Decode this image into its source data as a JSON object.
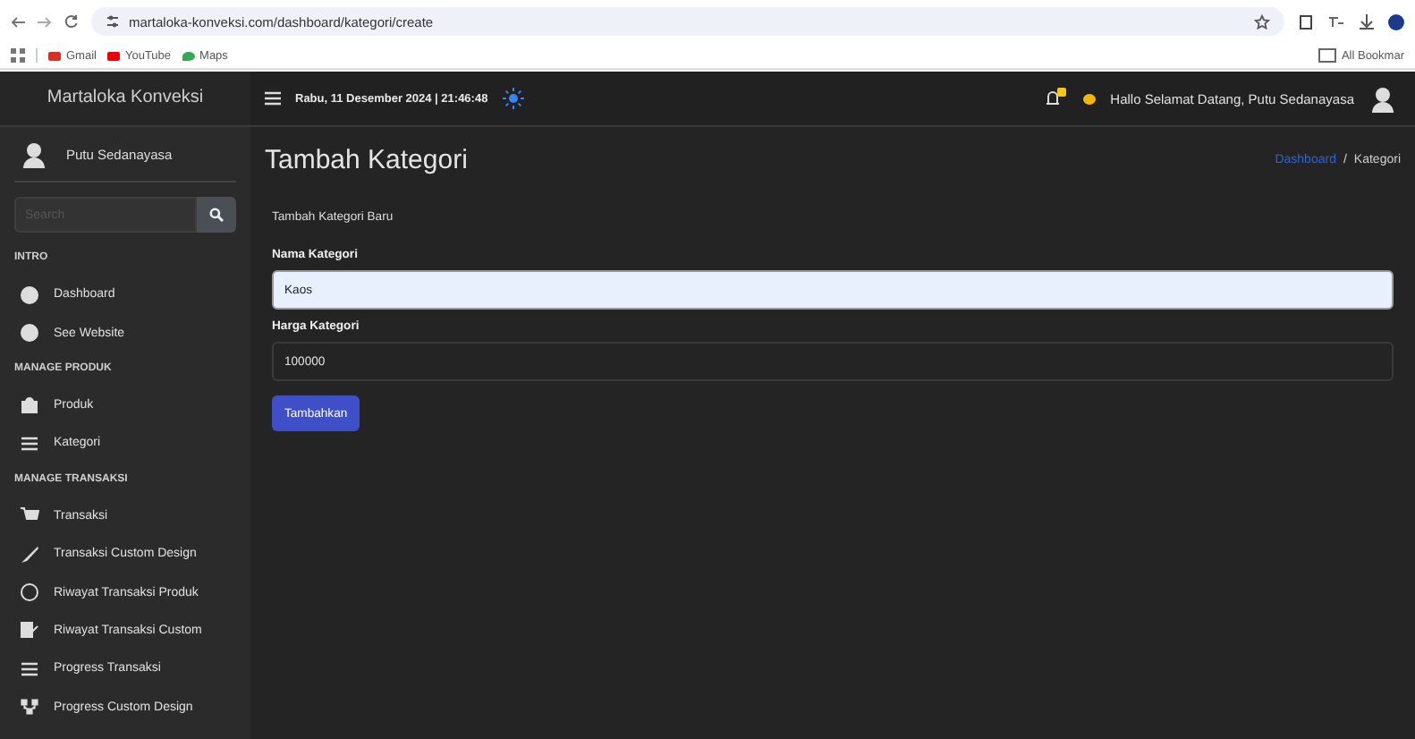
{
  "browser": {
    "url": "martaloka-konveksi.com/dashboard/kategori/create",
    "bookmarks": [
      {
        "label": "Gmail"
      },
      {
        "label": "YouTube"
      },
      {
        "label": "Maps"
      }
    ],
    "all_bookmarks": "All Bookmar"
  },
  "header": {
    "brand": "Martaloka Konveksi",
    "date_time": "Rabu, 11 Desember 2024 | 21:46:48",
    "greeting": "Hallo Selamat Datang, Putu Sedanayasa"
  },
  "sidebar": {
    "user_name": "Putu Sedanayasa",
    "search": {
      "placeholder": "Search"
    },
    "sections": [
      {
        "heading": "INTRO",
        "items": [
          {
            "label": "Dashboard"
          },
          {
            "label": "See Website"
          }
        ]
      },
      {
        "heading": "MANAGE PRODUK",
        "items": [
          {
            "label": "Produk"
          },
          {
            "label": "Kategori"
          }
        ]
      },
      {
        "heading": "MANAGE TRANSAKSI",
        "items": [
          {
            "label": "Transaksi"
          },
          {
            "label": "Transaksi Custom Design"
          },
          {
            "label": "Riwayat Transaksi Produk"
          },
          {
            "label": "Riwayat Transaksi Custom"
          },
          {
            "label": "Progress Transaksi"
          },
          {
            "label": "Progress Custom Design"
          }
        ]
      }
    ]
  },
  "main": {
    "title": "Tambah Kategori",
    "breadcrumb": [
      {
        "label": "Dashboard",
        "kind": "link"
      },
      {
        "label": "/",
        "kind": "separator"
      },
      {
        "label": "Kategori",
        "kind": "current"
      }
    ],
    "card": {
      "subtitle": "Tambah Kategori Baru",
      "fields": [
        {
          "label": "Nama Kategori",
          "value": "Kaos",
          "focused": true
        },
        {
          "label": "Harga Kategori",
          "value": "100000",
          "focused": false
        }
      ],
      "button": "Tambahkan"
    }
  }
}
